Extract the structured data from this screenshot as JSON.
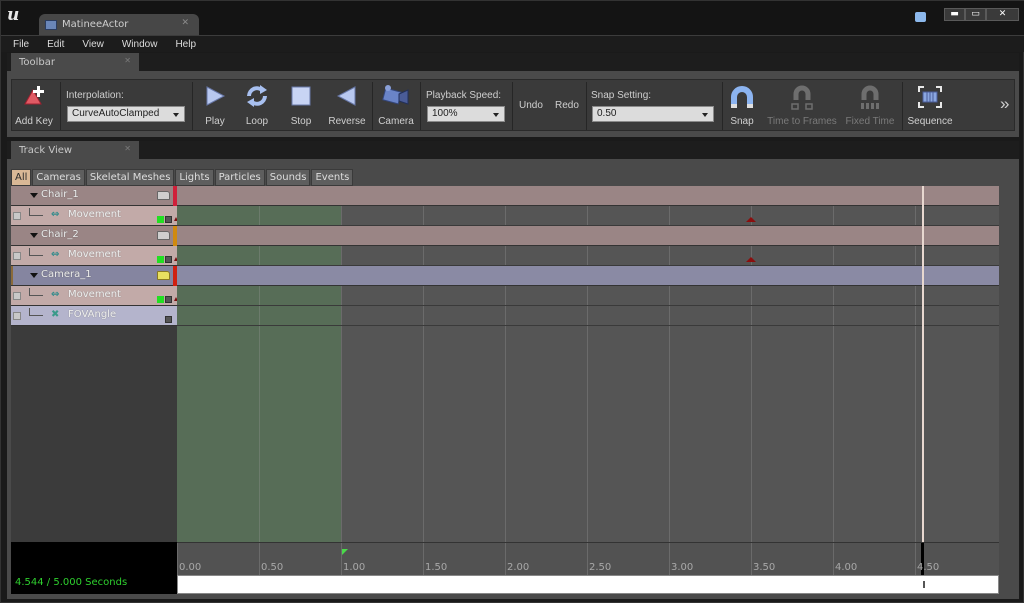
{
  "window": {
    "doc_tab": "MatineeActor",
    "controls": {
      "minimize": "▬",
      "maximize": "▭",
      "close": "✕"
    }
  },
  "menu": [
    "File",
    "Edit",
    "View",
    "Window",
    "Help"
  ],
  "panels": {
    "toolbar_tab": "Toolbar",
    "trackview_tab": "Track View"
  },
  "toolbar": {
    "add_key": "Add Key",
    "interpolation_label": "Interpolation:",
    "interpolation_value": "CurveAutoClamped",
    "play": "Play",
    "loop": "Loop",
    "stop": "Stop",
    "reverse": "Reverse",
    "camera": "Camera",
    "playback_speed_label": "Playback Speed:",
    "playback_speed_value": "100%",
    "undo": "Undo",
    "redo": "Redo",
    "snap_setting_label": "Snap Setting:",
    "snap_setting_value": "0.50",
    "snap": "Snap",
    "time_to_frames": "Time to Frames",
    "fixed_time": "Fixed Time",
    "sequence": "Sequence",
    "overflow": "»"
  },
  "group_tabs": [
    {
      "label": "All",
      "active": true
    },
    {
      "label": "Cameras",
      "active": false
    },
    {
      "label": "Skeletal Meshes",
      "active": false
    },
    {
      "label": "Lights",
      "active": false
    },
    {
      "label": "Particles",
      "active": false
    },
    {
      "label": "Sounds",
      "active": false
    },
    {
      "label": "Events",
      "active": false
    }
  ],
  "tracks": [
    {
      "type": "group",
      "name": "Chair_1",
      "color": "#d0203a",
      "kind": "chair"
    },
    {
      "type": "sub",
      "name": "Movement",
      "icon": "⇔",
      "kind": "move",
      "key_time": 3.5
    },
    {
      "type": "group",
      "name": "Chair_2",
      "color": "#d08a10",
      "kind": "chair"
    },
    {
      "type": "sub",
      "name": "Movement",
      "icon": "⇔",
      "kind": "move",
      "key_time": 3.5
    },
    {
      "type": "group",
      "name": "Camera_1",
      "color": "#d02010",
      "kind": "cam"
    },
    {
      "type": "sub",
      "name": "Movement",
      "icon": "⇔",
      "kind": "move"
    },
    {
      "type": "sub",
      "name": "FOVAngle",
      "icon": "✖",
      "kind": "fov"
    }
  ],
  "timeline": {
    "readout": "4.544 / 5.000 Seconds",
    "current_time": 4.544,
    "total_time": 5.0,
    "loop_start": 0.0,
    "loop_end": 1.0,
    "ticks": [
      "0.00",
      "0.50",
      "1.00",
      "1.50",
      "2.00",
      "2.50",
      "3.00",
      "3.50",
      "4.00",
      "4.50"
    ]
  },
  "colors": {
    "accent_green": "#2ed02e",
    "group_row": "#9a8585",
    "camera_row": "#8a8aa4",
    "key_marker": "#8a0e0e"
  }
}
